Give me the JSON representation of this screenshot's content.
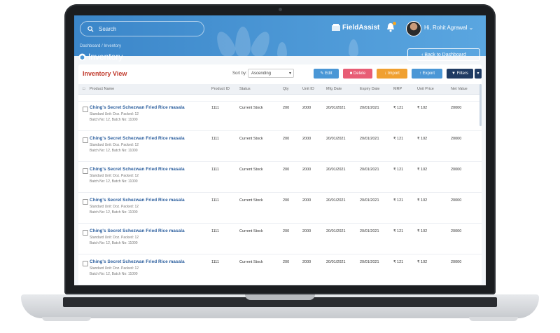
{
  "header": {
    "search_placeholder": "Search",
    "logo_text": "FieldAssist",
    "user_name": "Hi, Rohit Agrawal",
    "breadcrumb": "Dashboard  /  Inventory",
    "page_title": "Inventory",
    "back_button": "Back to Dashboard"
  },
  "panel": {
    "title": "Inventory View",
    "sort_label": "Sort by:",
    "sort_value": "Ascending",
    "buttons": {
      "edit": "Edit",
      "delete": "Delete",
      "import": "Import",
      "export": "Export",
      "filters": "Filters"
    }
  },
  "columns": [
    "Product Name",
    "Product ID",
    "Status",
    "Qty",
    "Unit ID",
    "Mfg Date",
    "Expiry Date",
    "MRP",
    "Unit Price",
    "Net Value"
  ],
  "rows": [
    {
      "name": "Ching's Secret Schezwan Fried Rice masala",
      "sub1": "Standard Unit: Doz. Packed: 12",
      "sub2": "Batch No: 12, Batch No: 11000",
      "id": "1111",
      "status": "Current Stock",
      "qty": "200",
      "unit": "2000",
      "mfg": "20/01/2021",
      "exp": "20/01/2021",
      "mrp": "₹ 121",
      "price": "₹ 102",
      "net": "20000"
    },
    {
      "name": "Ching's Secret Schezwan Fried Rice masala",
      "sub1": "Standard Unit: Doz. Packed: 12",
      "sub2": "Batch No: 12, Batch No: 11000",
      "id": "1111",
      "status": "Current Stock",
      "qty": "200",
      "unit": "2000",
      "mfg": "20/01/2021",
      "exp": "20/01/2021",
      "mrp": "₹ 121",
      "price": "₹ 102",
      "net": "20000"
    },
    {
      "name": "Ching's Secret Schezwan Fried Rice masala",
      "sub1": "Standard Unit: Doz. Packed: 12",
      "sub2": "Batch No: 12, Batch No: 11000",
      "id": "1111",
      "status": "Current Stock",
      "qty": "200",
      "unit": "2000",
      "mfg": "20/01/2021",
      "exp": "20/01/2021",
      "mrp": "₹ 121",
      "price": "₹ 102",
      "net": "20000"
    },
    {
      "name": "Ching's Secret Schezwan Fried Rice masala",
      "sub1": "Standard Unit: Doz. Packed: 12",
      "sub2": "Batch No: 12, Batch No: 11000",
      "id": "1111",
      "status": "Current Stock",
      "qty": "200",
      "unit": "2000",
      "mfg": "20/01/2021",
      "exp": "20/01/2021",
      "mrp": "₹ 121",
      "price": "₹ 102",
      "net": "20000"
    },
    {
      "name": "Ching's Secret Schezwan Fried Rice masala",
      "sub1": "Standard Unit: Doz. Packed: 12",
      "sub2": "Batch No: 12, Batch No: 11000",
      "id": "1111",
      "status": "Current Stock",
      "qty": "200",
      "unit": "2000",
      "mfg": "20/01/2021",
      "exp": "20/01/2021",
      "mrp": "₹ 121",
      "price": "₹ 102",
      "net": "20000"
    },
    {
      "name": "Ching's Secret Schezwan Fried Rice masala",
      "sub1": "Standard Unit: Doz. Packed: 12",
      "sub2": "Batch No: 12, Batch No: 11000",
      "id": "1111",
      "status": "Current Stock",
      "qty": "200",
      "unit": "2000",
      "mfg": "20/01/2021",
      "exp": "20/01/2021",
      "mrp": "₹ 121",
      "price": "₹ 102",
      "net": "20000"
    }
  ],
  "colors": {
    "header": "#4a97d6",
    "edit": "#4a97d6",
    "delete": "#e85d75",
    "import": "#f0a030",
    "export": "#4a97d6",
    "filters": "#1f3b63",
    "title_red": "#c0392b"
  },
  "icons": [
    "search-icon",
    "fieldassist-logo-icon",
    "bell-icon",
    "avatar",
    "inventory-icon",
    "back-arrow-icon",
    "edit-icon",
    "delete-icon",
    "import-icon",
    "export-icon",
    "filter-icon",
    "chevron-down-icon"
  ]
}
